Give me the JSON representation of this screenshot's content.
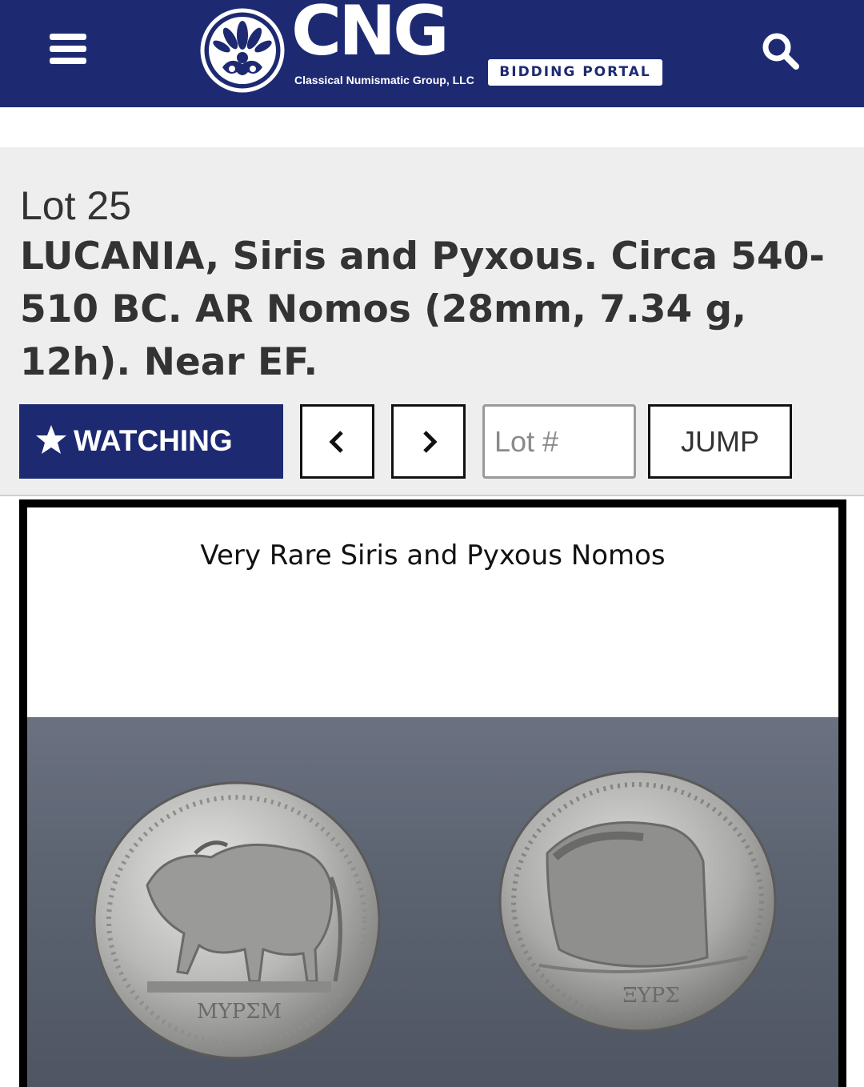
{
  "header": {
    "logo_text": "CNG",
    "logo_subtitle": "Classical Numismatic Group, LLC",
    "portal_label": "BIDDING PORTAL",
    "menu_icon": "hamburger-menu-icon",
    "search_icon": "search-icon",
    "background_color": "#1d2a72"
  },
  "lot": {
    "number_label": "Lot 25",
    "title": "LUCANIA, Siris and Pyxous. Circa 540-510 BC. AR Nomos (28mm, 7.34 g, 12h). Near EF."
  },
  "controls": {
    "watch_label": "WATCHING",
    "watch_icon": "star-icon",
    "prev_icon": "chevron-left-icon",
    "next_icon": "chevron-right-icon",
    "lot_input_placeholder": "Lot #",
    "jump_label": "JUMP"
  },
  "image": {
    "caption": "Very Rare Siris and Pyxous Nomos",
    "description_icon": "coin-photo"
  }
}
